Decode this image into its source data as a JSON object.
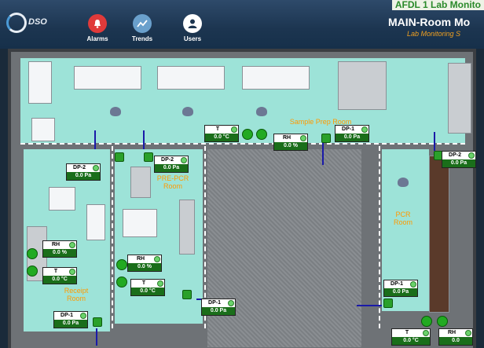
{
  "header": {
    "logo_text": "DSO",
    "top_title": "AFDL 1 Lab Monito",
    "main_title": "MAIN-Room Mo",
    "sub_title": "Lab Monitoring S",
    "nav": [
      {
        "label": "Alarms",
        "icon": "alarm-bell-icon",
        "color": "#e03a3a"
      },
      {
        "label": "Trends",
        "icon": "trend-chart-icon",
        "color": "#6aa0cc"
      },
      {
        "label": "Users",
        "icon": "user-icon",
        "color": "#ffffff"
      }
    ]
  },
  "rooms": {
    "sample_prep": "Sample Prep Room",
    "pre_pcr_1": "PRE-PCR",
    "pre_pcr_2": "Room",
    "receipt_1": "Receipt",
    "receipt_2": "Room",
    "pcr_1": "PCR",
    "pcr_2": "Room"
  },
  "sensors": {
    "sp_t": {
      "label": "T",
      "value": "0.0 °C"
    },
    "sp_rh": {
      "label": "RH",
      "value": "0.0 %"
    },
    "sp_dp1": {
      "label": "DP-1",
      "value": "0.0 Pa"
    },
    "rc_dp2": {
      "label": "DP-2",
      "value": "0.0 Pa"
    },
    "pre_dp2": {
      "label": "DP-2",
      "value": "0.0 Pa"
    },
    "pcr_dp2": {
      "label": "DP-2",
      "value": "0.0 Pa"
    },
    "rc_rh": {
      "label": "RH",
      "value": "0.0 %"
    },
    "rc_t": {
      "label": "T",
      "value": "0.0 °C"
    },
    "pre_rh": {
      "label": "RH",
      "value": "0.0 %"
    },
    "pre_t": {
      "label": "T",
      "value": "0.0 °C"
    },
    "pcr_dp1": {
      "label": "DP-1",
      "value": "0.0 Pa"
    },
    "mid_dp1": {
      "label": "DP-1",
      "value": "0.0 Pa"
    },
    "rc_dp1": {
      "label": "DP-1",
      "value": "0.0 Pa"
    },
    "bot_t": {
      "label": "T",
      "value": "0.0 °C"
    },
    "bot_rh": {
      "label": "RH",
      "value": "0.0"
    }
  },
  "colors": {
    "room_floor": "#9de3d8",
    "room_label": "#ff9a00",
    "sensor_value_bg": "#1a6e1a",
    "pressure_line": "#1a1aa8"
  }
}
